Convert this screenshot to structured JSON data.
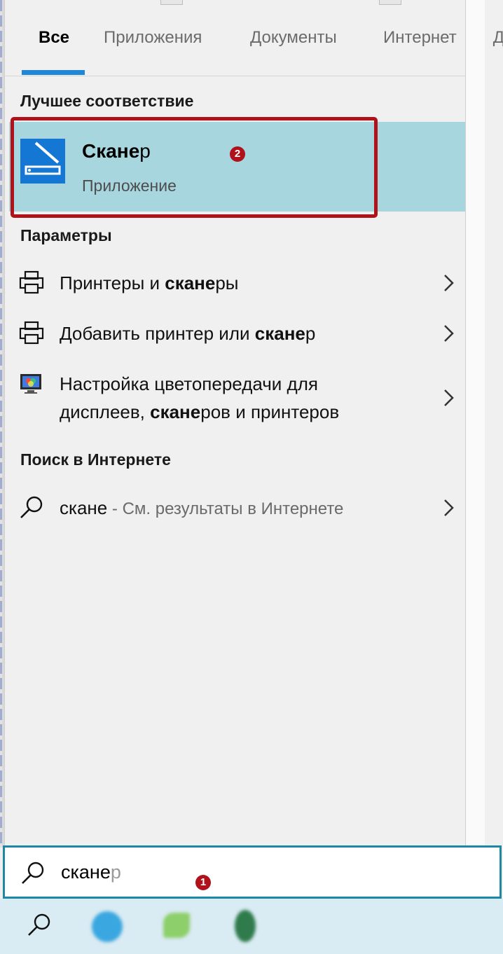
{
  "tabs": [
    {
      "label": "Все",
      "active": true
    },
    {
      "label": "Приложения",
      "active": false
    },
    {
      "label": "Документы",
      "active": false
    },
    {
      "label": "Интернет",
      "active": false
    }
  ],
  "tab_overflow_label": "Д",
  "best_match": {
    "section_title": "Лучшее соответствие",
    "title_bold": "Скане",
    "title_rest": "р",
    "subtitle": "Приложение",
    "marker": "2"
  },
  "settings": {
    "section_title": "Параметры",
    "items": [
      {
        "pre": "Принтеры и ",
        "bold": "скане",
        "post": "ры"
      },
      {
        "pre": "Добавить принтер или ",
        "bold": "скане",
        "post": "р"
      },
      {
        "line1": "Настройка цветопередачи для",
        "pre": "дисплеев, ",
        "bold": "скане",
        "post": "ров и принтеров"
      }
    ]
  },
  "web": {
    "section_title": "Поиск в Интернете",
    "query": "скане",
    "suffix": " - См. результаты в Интернете"
  },
  "search": {
    "typed": "скане",
    "completion": "р",
    "marker": "1"
  },
  "colors": {
    "accent": "#1f87d6",
    "highlight": "#a7d6df",
    "annotation": "#b0121c",
    "taskbar": "#d9ebf3"
  },
  "icons": [
    "scanner-app-icon",
    "printer-icon",
    "color-calibration-icon",
    "search-icon",
    "chevron-right-icon",
    "telegram-icon",
    "app-icon-green-bird",
    "app-icon-green-oval"
  ]
}
